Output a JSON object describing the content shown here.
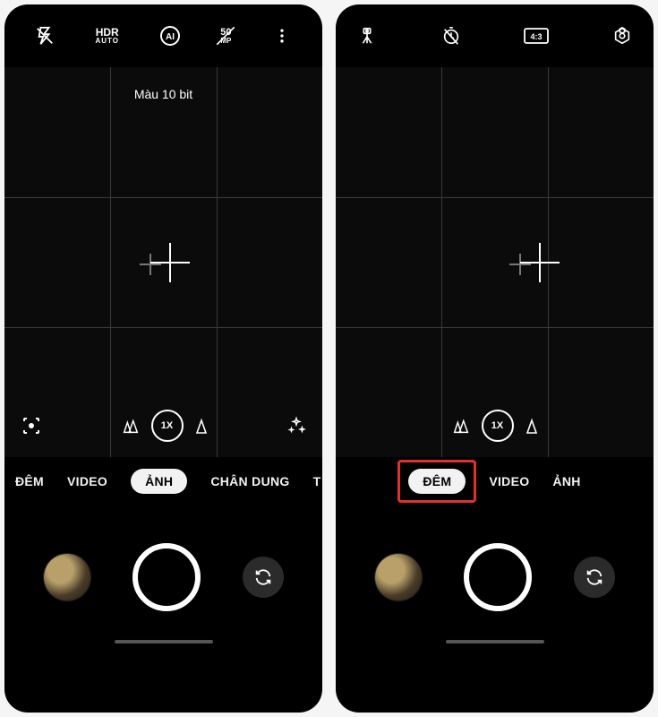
{
  "left": {
    "topbar": [
      "flash-off",
      "hdr-auto",
      "ai-scene",
      "50mp",
      "more-menu"
    ],
    "badge": "Màu 10 bit",
    "zoom_label": "1X",
    "modes": [
      {
        "label": "ĐÊM",
        "active": false
      },
      {
        "label": "VIDEO",
        "active": false
      },
      {
        "label": "ẢNH",
        "active": true
      },
      {
        "label": "CHÂN DUNG",
        "active": false
      },
      {
        "label": "T",
        "active": false
      }
    ]
  },
  "right": {
    "topbar": [
      "tripod",
      "timer-off",
      "aspect-4-3",
      "settings"
    ],
    "zoom_label": "1X",
    "modes": [
      {
        "label": "ĐÊM",
        "active": true,
        "highlight": true
      },
      {
        "label": "VIDEO",
        "active": false
      },
      {
        "label": "ẢNH",
        "active": false
      }
    ]
  }
}
